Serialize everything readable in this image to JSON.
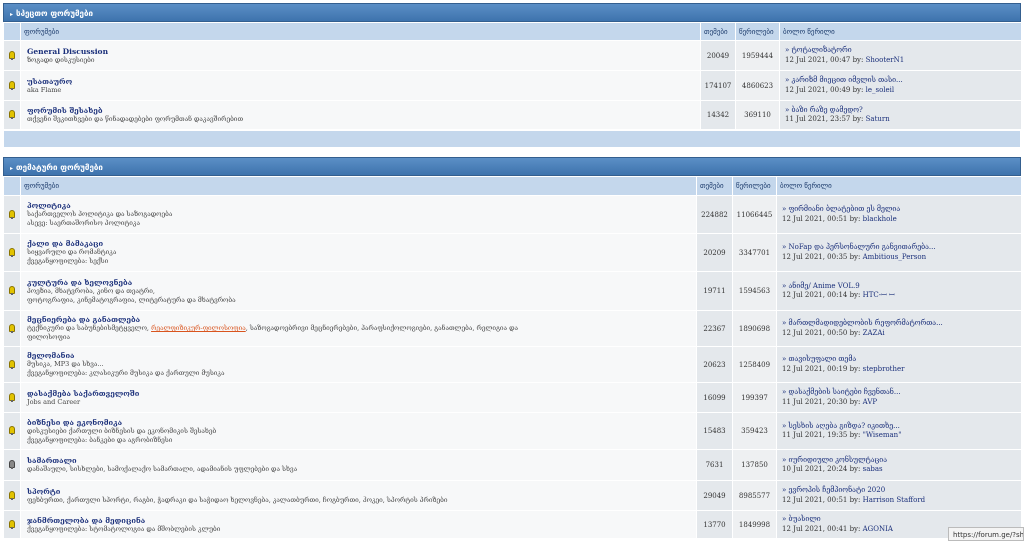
{
  "sections": [
    {
      "title": "სპეცთო ფორუმები",
      "headers": {
        "forum": "ფორუმები",
        "topics": "თემები",
        "posts": "წერილები",
        "last": "ბოლო წერილი"
      },
      "forums": [
        {
          "name": "General Discussion",
          "desc": [
            "ზოგადი დისკუსიები"
          ],
          "topics": "20049",
          "posts": "1959444",
          "last_title": "» ტოტალიზატორი",
          "last_date": "12 Jul 2021, 00:47 by:",
          "last_user": "ShooterN1",
          "icon_state": "on"
        },
        {
          "name": "უსათაურო",
          "desc": [
            "aka Flame"
          ],
          "topics": "174107",
          "posts": "4860623",
          "last_title": "» კარიზმ მიეცით იმვლის თასი...",
          "last_date": "12 Jul 2021, 00:49 by:",
          "last_user": "le_soleil",
          "icon_state": "on"
        },
        {
          "name": "ფორუმის შესახებ",
          "desc": [
            "თქვენი შეკითხვები და წინადადებები ფორუმთან დაკავშირებით"
          ],
          "topics": "14342",
          "posts": "369110",
          "last_title": "» ბაზი რაზე დამედო?",
          "last_date": "11 Jul 2021, 23:57 by:",
          "last_user": "Saturn",
          "icon_state": "on"
        }
      ]
    },
    {
      "title": "თემატური ფორუმები",
      "headers": {
        "forum": "ფორუმები",
        "topics": "თემები",
        "posts": "წერილები",
        "last": "ბოლო წერილი"
      },
      "forums": [
        {
          "name": "პოლიტიკა",
          "desc": [
            "საქართველოს პოლიტიკა და საზოგადოება",
            "ასევე: საერთაშორისო პოლიტიკა"
          ],
          "topics": "224882",
          "posts": "11066445",
          "last_title": "» ფირმიანი ბლატებით ეს მელია",
          "last_date": "12 Jul 2021, 00:51 by:",
          "last_user": "blackhole",
          "icon_state": "on"
        },
        {
          "name": "ქალი და მამაკაცი",
          "desc": [
            "სიყვარული და რომანტიკა",
            "ქვეგანყოფილება: სექსი"
          ],
          "topics": "20209",
          "posts": "3347701",
          "last_title": "» NoFap და პერსონალური განვითარება...",
          "last_date": "12 Jul 2021, 00:35 by:",
          "last_user": "Ambitious_Person",
          "icon_state": "on"
        },
        {
          "name": "კულტურა და ხელოვნება",
          "desc": [
            "პოეზია, მხატვრობა, კინო და თეატრი,",
            "ფოტოგრაფია, კინემატოგრაფია, ლიტერატურა და მხატვრობა"
          ],
          "topics": "19711",
          "posts": "1594563",
          "last_title": "» ანიმე/ Anime VOL.9",
          "last_date": "12 Jul 2021, 00:14 by:",
          "last_user": "HTC-ꟷ ꟷ",
          "icon_state": "on"
        },
        {
          "name": "მეცნიერება და განათლება",
          "desc_pre": "ტექნიკური და საბუნებისმეტყველო, ",
          "desc_hl": "რეალფიზიკურ-ფილოსოფია",
          "desc_post": ", საზოგადოებრივი მეცნიერებები, პარაფსიქოლოგიები, განათლება, რელიგია და",
          "desc2": "ფილოსოფია",
          "topics": "22367",
          "posts": "1890698",
          "last_title": "» მართლმადიდებლობის რეფორმატორთა...",
          "last_date": "12 Jul 2021, 00:50 by:",
          "last_user": "ZAZAi",
          "icon_state": "on"
        },
        {
          "name": "მელომანია",
          "desc": [
            "მუსიკა, MP3 და სხვა...",
            "ქვეგანყოფილება: კლასიკური მუსიკა და ქართული მუსიკა"
          ],
          "topics": "20623",
          "posts": "1258409",
          "last_title": "» თავისუფალი თემა",
          "last_date": "12 Jul 2021, 00:19 by:",
          "last_user": "stepbrother",
          "icon_state": "on"
        },
        {
          "name": "დასაქმება საქართველოში",
          "desc": [
            "Jobs and Career"
          ],
          "topics": "16099",
          "posts": "199397",
          "last_title": "» დასაქმების საიტები ჩვენთან...",
          "last_date": "11 Jul 2021, 20:30 by:",
          "last_user": "AVP",
          "icon_state": "on"
        },
        {
          "name": "ბიზნესი და ეკონომიკა",
          "desc": [
            "დისკუსიები ქართული ბიზნესის და ეკონომიკის შესახებ",
            "ქვეგანყოფილება: ბანკები და აგრობიზნესი"
          ],
          "topics": "15483",
          "posts": "359423",
          "last_title": "» სესხის აღება გიზდა? იკითხე...",
          "last_date": "11 Jul 2021, 19:35 by:",
          "last_user": "\"Wiseman\"",
          "icon_state": "on"
        },
        {
          "name": "სამართალი",
          "desc": [
            "დანაშაული, სისხლები, სამოქალაქო სამართალი, ადამიანის უფლებები და სხვა"
          ],
          "topics": "7631",
          "posts": "137850",
          "last_title": "» იურიდიული კონსულტაცია",
          "last_date": "10 Jul 2021, 20:24 by:",
          "last_user": "sabas",
          "icon_state": "off"
        },
        {
          "name": "სპორტი",
          "desc": [
            "ფეხბურთი, ქართული სპორტი, რაგბი, ჭადრაკი და საჭიდაო ხელოვნება, კალათბურთი, ჩოგბურთი, ჰოკეი, სპორტის პრიზები"
          ],
          "topics": "29049",
          "posts": "8985577",
          "last_title": "» ევროპის ჩემპიონატი 2020",
          "last_date": "12 Jul 2021, 00:51 by:",
          "last_user": "Harrison Stafford",
          "icon_state": "on"
        },
        {
          "name": "ჯანმრთელობა და მედიცინა",
          "desc": [
            "ქვეგანყოფილება: სტომატოლოგია და მშობლების კლუბი"
          ],
          "topics": "13770",
          "posts": "1849998",
          "last_title": "» ბუასილი",
          "last_date": "12 Jul 2021, 00:41 by:",
          "last_user": "AGONIA",
          "icon_state": "on"
        }
      ]
    }
  ],
  "status_bar": {
    "url": "https://forum.ge/?sho"
  }
}
